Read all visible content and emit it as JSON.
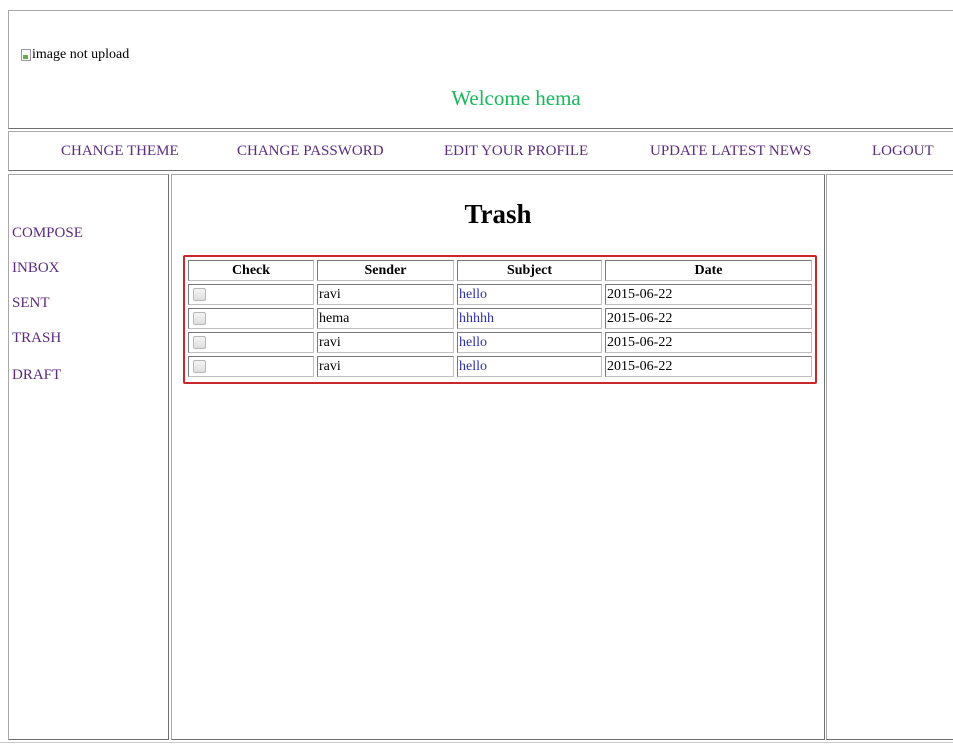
{
  "header": {
    "image_alt": "image not upload",
    "welcome": "Welcome hema"
  },
  "nav": {
    "items": [
      {
        "label": "CHANGE THEME"
      },
      {
        "label": "CHANGE PASSWORD"
      },
      {
        "label": "EDIT YOUR PROFILE"
      },
      {
        "label": "UPDATE LATEST NEWS"
      },
      {
        "label": "LOGOUT"
      }
    ]
  },
  "sidebar": {
    "items": [
      {
        "label": "COMPOSE"
      },
      {
        "label": "INBOX"
      },
      {
        "label": "SENT"
      },
      {
        "label": "TRASH"
      },
      {
        "label": "DRAFT"
      }
    ]
  },
  "main": {
    "title": "Trash",
    "columns": [
      "Check",
      "Sender",
      "Subject",
      "Date"
    ],
    "rows": [
      {
        "checked": false,
        "sender": "ravi",
        "subject": "hello",
        "date": "2015-06-22"
      },
      {
        "checked": false,
        "sender": "hema",
        "subject": "hhhhh",
        "date": "2015-06-22"
      },
      {
        "checked": false,
        "sender": "ravi",
        "subject": "hello",
        "date": "2015-06-22"
      },
      {
        "checked": false,
        "sender": "ravi",
        "subject": "hello",
        "date": "2015-06-22"
      }
    ]
  },
  "colors": {
    "welcome": "#19b85a",
    "link": "#5b2b7e",
    "subject_link": "#2c2fa8",
    "table_highlight": "#c8282c"
  },
  "icons": {
    "broken_image": "broken-image-icon",
    "checkbox": "checkbox-icon"
  }
}
